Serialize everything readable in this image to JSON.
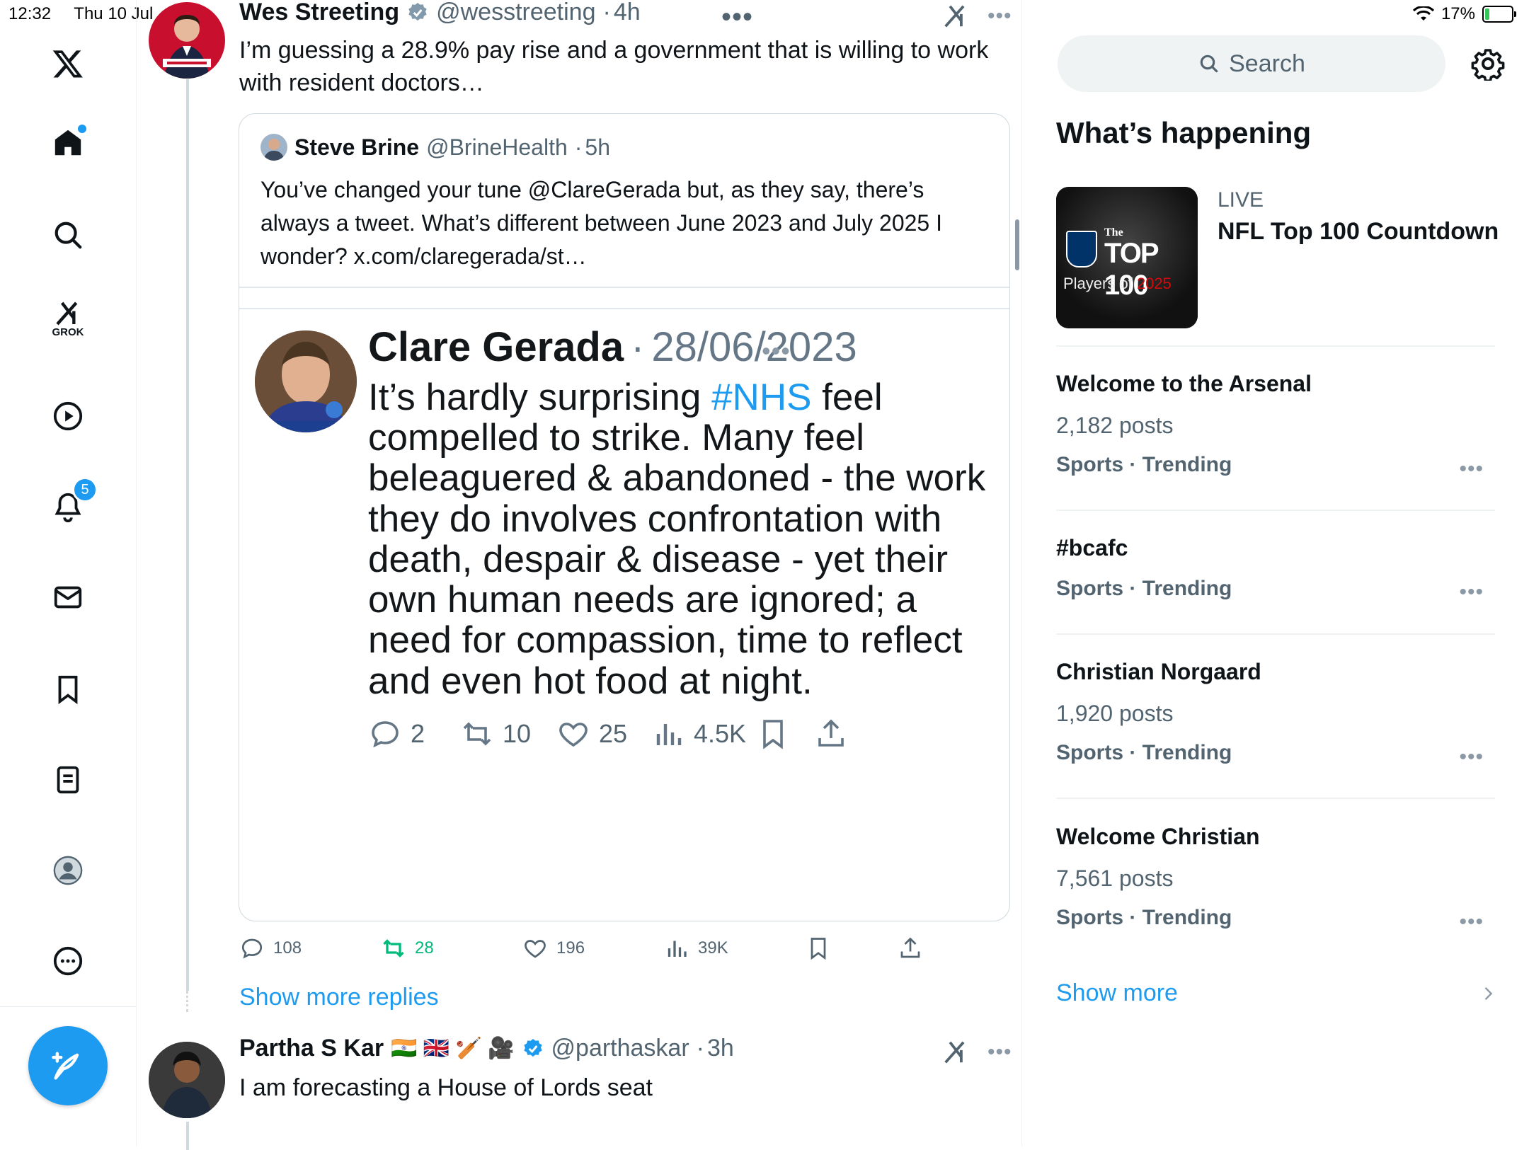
{
  "status_bar": {
    "time": "12:32",
    "date": "Thu 10 Jul",
    "battery": "17%",
    "battery_level": 0.17
  },
  "nav": {
    "grok_label": "GROK",
    "notifications_badge": "5"
  },
  "colors": {
    "accent": "#1d9bf0",
    "retweet_active": "#00ba7c",
    "text_secondary": "#536471"
  },
  "main_tweet": {
    "name": "Wes Streeting",
    "handle": "@wesstreeting",
    "time": "4h",
    "text": "I’m guessing a 28.9% pay rise and a government that is willing to work with resident doctors…",
    "quote": {
      "name": "Steve Brine",
      "handle": "@BrineHealth",
      "time": "5h",
      "text": "You’ve changed your tune @ClareGerada but, as they say, there’s always a tweet. What’s different between June 2023 and July 2025 I wonder? x.com/claregerada/st…",
      "screenshot": {
        "name": "Clare Gerada",
        "date": "28/06/2023",
        "text_before": "It’s hardly surprising ",
        "hashtag": "#NHS",
        "text_after": " feel compelled to strike. Many feel beleaguered & abandoned - the work they do involves confrontation with death, despair & disease - yet their own human needs are ignored; a need for compassion, time to reflect and even hot food at night.",
        "replies": "2",
        "retweets": "10",
        "likes": "25",
        "views": "4.5K"
      }
    },
    "replies": "108",
    "retweets": "28",
    "likes": "196",
    "views": "39K"
  },
  "show_more_replies": "Show more replies",
  "next_tweet": {
    "name": "Partha S Kar",
    "name_emojis": "🇮🇳 🇬🇧 🏏 🎥",
    "handle": "@parthaskar",
    "time": "3h",
    "text": "I am forecasting a House of Lords seat"
  },
  "sidebar": {
    "search_placeholder": "Search",
    "section_title": "What’s happening",
    "live": {
      "label": "LIVE",
      "title": "NFL Top 100 Countdown",
      "thumb_line1": "The",
      "thumb_line2": "TOP 100",
      "thumb_line3a": "Players of ",
      "thumb_line3b": "2025"
    },
    "trends": [
      {
        "title": "Welcome to the Arsenal",
        "count": "2,182 posts",
        "context": "Sports · Trending"
      },
      {
        "title": "#bcafc",
        "count": "",
        "context": "Sports · Trending"
      },
      {
        "title": "Christian Norgaard",
        "count": "1,920 posts",
        "context": "Sports · Trending"
      },
      {
        "title": "Welcome Christian",
        "count": "7,561 posts",
        "context": "Sports · Trending"
      }
    ],
    "show_more": "Show more"
  }
}
